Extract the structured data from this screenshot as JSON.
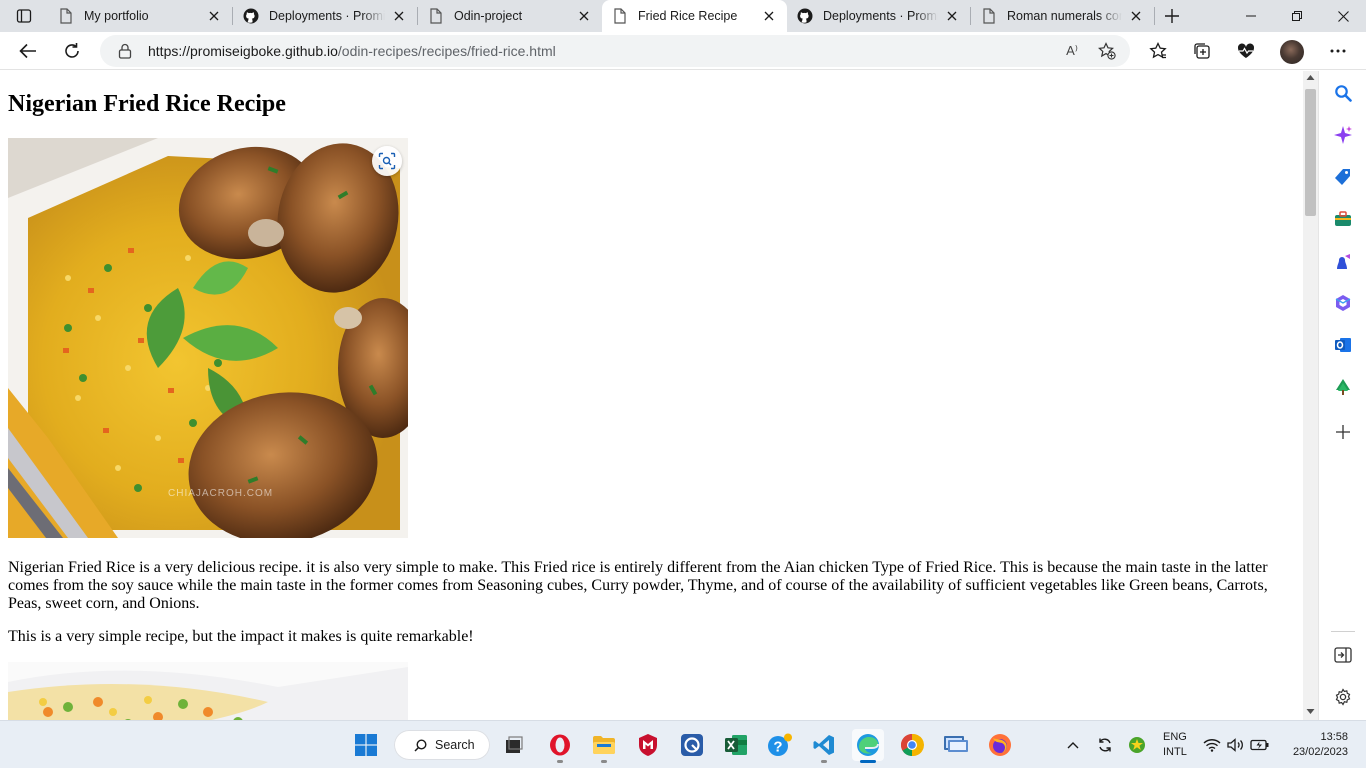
{
  "browser": {
    "tabs": [
      {
        "title": "My portfolio",
        "icon": "page-icon",
        "active": false
      },
      {
        "title": "Deployments · PromiseIgboke",
        "icon": "github-icon",
        "active": false
      },
      {
        "title": "Odin-project",
        "icon": "page-icon",
        "active": false
      },
      {
        "title": "Fried Rice Recipe",
        "icon": "page-icon",
        "active": true
      },
      {
        "title": "Deployments · PromiseIgboke",
        "icon": "github-icon",
        "active": false
      },
      {
        "title": "Roman numerals converter",
        "icon": "page-icon",
        "active": false
      }
    ],
    "url_host": "https://promiseigboke.github.io",
    "url_path": "/odin-recipes/recipes/fried-rice.html",
    "read_aloud_label": "A⁾"
  },
  "page": {
    "title": "Nigerian Fried Rice Recipe",
    "image_watermark": "CHIAJACROH.COM",
    "paragraph1": "Nigerian Fried Rice is a very delicious recipe. it is also very simple to make. This Fried rice is entirely different from the Aian chicken Type of Fried Rice. This is because the main taste in the latter comes from the soy sauce while the main taste in the former comes from Seasoning cubes, Curry powder, Thyme, and of course of the availability of sufficient vegetables like Green beans, Carrots, Peas, sweet corn, and Onions.",
    "paragraph2": "This is a very simple recipe, but the impact it makes is quite remarkable!"
  },
  "sidebar": {
    "icons": [
      "search-icon",
      "copilot-icon",
      "shopping-icon",
      "tools-icon",
      "games-icon",
      "microsoft365-icon",
      "outlook-icon",
      "drop-tree-icon",
      "add-icon"
    ],
    "bottom_icons": [
      "hide-sidebar-icon",
      "settings-icon"
    ]
  },
  "taskbar": {
    "search_label": "Search",
    "language_line1": "ENG",
    "language_line2": "INTL",
    "time": "13:58",
    "date": "23/02/2023",
    "apps": [
      "start",
      "task-view",
      "opera",
      "file-explorer",
      "mcafee",
      "app-circle",
      "excel",
      "help",
      "vscode",
      "edge",
      "chrome",
      "remote-desktop",
      "firefox"
    ]
  },
  "colors": {
    "accent": "#0067c0",
    "tabbar": "#dfe2e6",
    "taskbar": "#e8eef5"
  }
}
